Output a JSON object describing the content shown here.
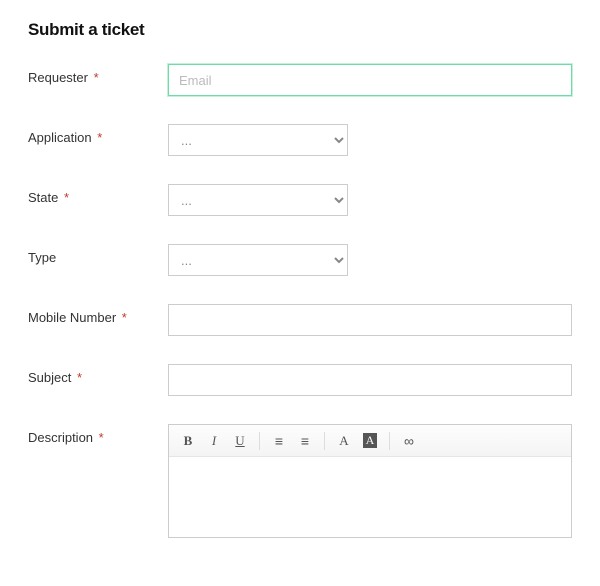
{
  "title": "Submit a ticket",
  "required_marker": "*",
  "fields": {
    "requester": {
      "label": "Requester",
      "required": true,
      "placeholder": "Email",
      "value": ""
    },
    "application": {
      "label": "Application",
      "required": true,
      "selected": "..."
    },
    "state": {
      "label": "State",
      "required": true,
      "selected": "..."
    },
    "type": {
      "label": "Type",
      "required": false,
      "selected": "..."
    },
    "mobile_number": {
      "label": "Mobile Number",
      "required": true,
      "value": ""
    },
    "subject": {
      "label": "Subject",
      "required": true,
      "value": ""
    },
    "description": {
      "label": "Description",
      "required": true,
      "value": ""
    }
  },
  "editor": {
    "bold": "B",
    "italic": "I",
    "underline": "U",
    "bulleted_list": "≡",
    "numbered_list": "≡",
    "text_color": "A",
    "background_color": "A",
    "link": "∞"
  }
}
